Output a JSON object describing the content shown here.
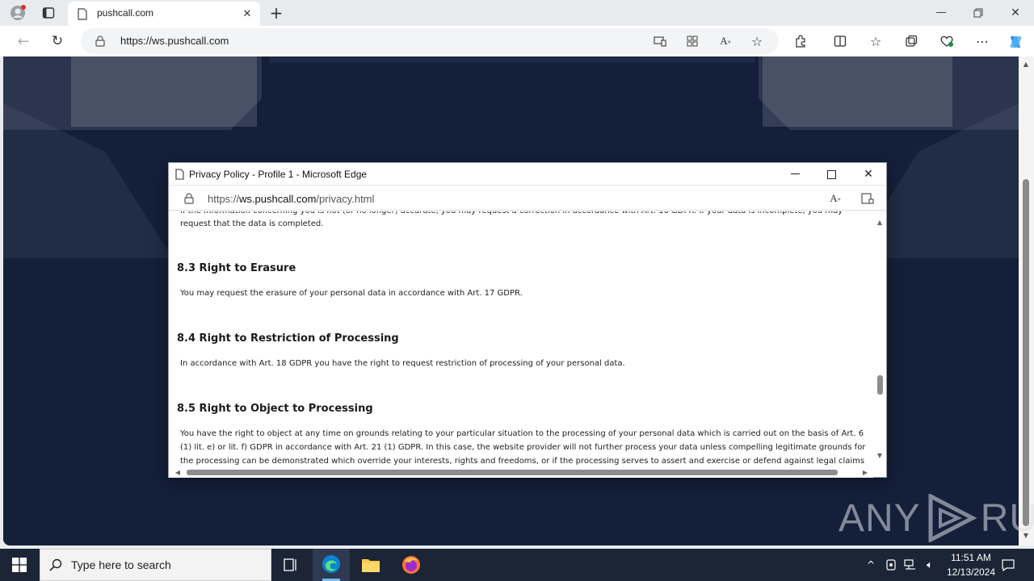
{
  "browser": {
    "tab_title": "pushcall.com",
    "url": "https://ws.pushcall.com",
    "new_tab_glyph": "+"
  },
  "popup": {
    "window_title": "Privacy Policy - Profile 1 - Microsoft Edge",
    "url_prefix": "https://",
    "url_host": "ws.pushcall.com",
    "url_path": "/privacy.html",
    "paragraph_cut": "If the information concerning you is not (or no longer) accurate, you may request a correction in accordance with Art. 16 GDPR. If your data is incomplete, you may",
    "paragraph_cut_end": "request that the data is completed.",
    "sections": [
      {
        "heading": "8.3 Right to Erasure",
        "text": "You may request the erasure of your personal data in accordance with Art. 17 GDPR."
      },
      {
        "heading": "8.4 Right to Restriction of Processing",
        "text": "In accordance with Art. 18 GDPR you have the right to request restriction of processing of your personal data."
      },
      {
        "heading": "8.5 Right to Object to Processing",
        "text_lines": [
          "You have the right to object at any time on grounds relating to your particular situation to the processing of your personal data which is carried out on the basis of Art. 6",
          "(1) lit. e) or lit. f) GDPR in accordance with Art. 21 (1) GDPR. In this case, the website provider will not further process your data unless compelling legitimate grounds for",
          "the processing can be demonstrated which override your interests, rights and freedoms, or if the processing serves to assert and exercise or defend against legal claims"
        ]
      }
    ]
  },
  "watermark": {
    "left": "ANY",
    "right": "RUN"
  },
  "taskbar": {
    "search_placeholder": "Type here to search",
    "time": "11:51 AM",
    "date": "12/13/2024"
  },
  "colors": {
    "page_bg": "#141f3a",
    "taskbar_bg": "#1c2535",
    "accent_edge": "#0a84d6"
  }
}
